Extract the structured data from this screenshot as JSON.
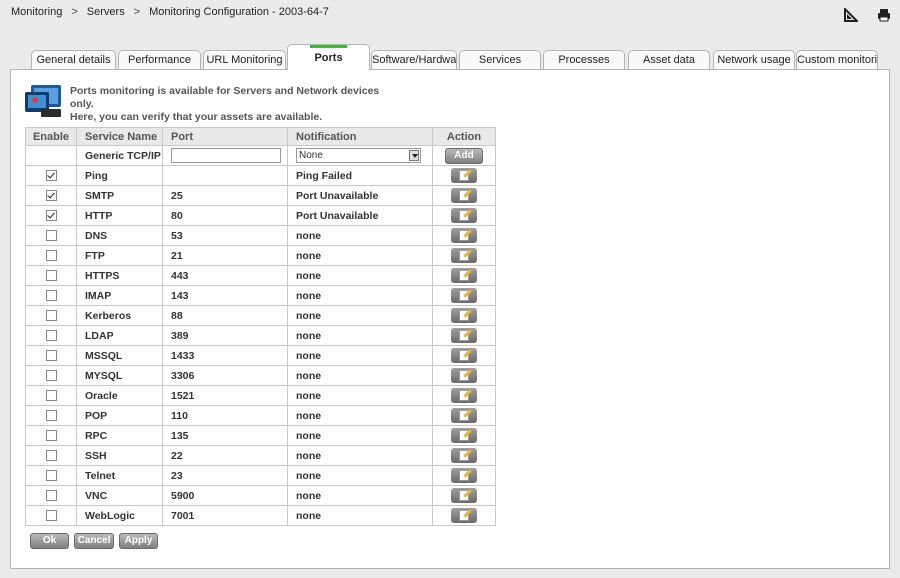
{
  "breadcrumb": [
    "Monitoring",
    "Servers",
    "Monitoring Configuration - 2003-64-7"
  ],
  "breadcrumb_separator": ">",
  "tabs": [
    {
      "label": "General details",
      "active": false
    },
    {
      "label": "Performance",
      "active": false
    },
    {
      "label": "URL Monitoring",
      "active": false
    },
    {
      "label": "Ports",
      "active": true
    },
    {
      "label": "Software/Hardwa...",
      "active": false
    },
    {
      "label": "Services",
      "active": false
    },
    {
      "label": "Processes",
      "active": false
    },
    {
      "label": "Asset data",
      "active": false
    },
    {
      "label": "Network usage",
      "active": false
    },
    {
      "label": "Custom monitoring",
      "active": false
    }
  ],
  "info": {
    "line1": "Ports monitoring is available for Servers and Network devices only.",
    "line2": "Here, you can verify that your assets are available."
  },
  "table": {
    "headers": {
      "enable": "Enable",
      "service": "Service Name",
      "port": "Port",
      "notification": "Notification",
      "action": "Action"
    },
    "new_row": {
      "service": "Generic TCP/IP",
      "port_value": "",
      "notification_selected": "None",
      "add_label": "Add"
    },
    "rows": [
      {
        "enabled": true,
        "service": "Ping",
        "port": "",
        "notification": "Ping Failed"
      },
      {
        "enabled": true,
        "service": "SMTP",
        "port": "25",
        "notification": "Port Unavailable"
      },
      {
        "enabled": true,
        "service": "HTTP",
        "port": "80",
        "notification": "Port Unavailable"
      },
      {
        "enabled": false,
        "service": "DNS",
        "port": "53",
        "notification": "none"
      },
      {
        "enabled": false,
        "service": "FTP",
        "port": "21",
        "notification": "none"
      },
      {
        "enabled": false,
        "service": "HTTPS",
        "port": "443",
        "notification": "none"
      },
      {
        "enabled": false,
        "service": "IMAP",
        "port": "143",
        "notification": "none"
      },
      {
        "enabled": false,
        "service": "Kerberos",
        "port": "88",
        "notification": "none"
      },
      {
        "enabled": false,
        "service": "LDAP",
        "port": "389",
        "notification": "none"
      },
      {
        "enabled": false,
        "service": "MSSQL",
        "port": "1433",
        "notification": "none"
      },
      {
        "enabled": false,
        "service": "MYSQL",
        "port": "3306",
        "notification": "none"
      },
      {
        "enabled": false,
        "service": "Oracle",
        "port": "1521",
        "notification": "none"
      },
      {
        "enabled": false,
        "service": "POP",
        "port": "110",
        "notification": "none"
      },
      {
        "enabled": false,
        "service": "RPC",
        "port": "135",
        "notification": "none"
      },
      {
        "enabled": false,
        "service": "SSH",
        "port": "22",
        "notification": "none"
      },
      {
        "enabled": false,
        "service": "Telnet",
        "port": "23",
        "notification": "none"
      },
      {
        "enabled": false,
        "service": "VNC",
        "port": "5900",
        "notification": "none"
      },
      {
        "enabled": false,
        "service": "WebLogic",
        "port": "7001",
        "notification": "none"
      }
    ]
  },
  "buttons": {
    "ok": "Ok",
    "cancel": "Cancel",
    "apply": "Apply"
  },
  "icons": {
    "top_right": [
      "ruler-icon",
      "print-icon"
    ],
    "info": "monitor-icon",
    "action": "edit-icon"
  },
  "colors": {
    "active_tab_accent": "#3cbd2f",
    "background": "#ebebeb",
    "button_gray": "#8a8a8a"
  }
}
